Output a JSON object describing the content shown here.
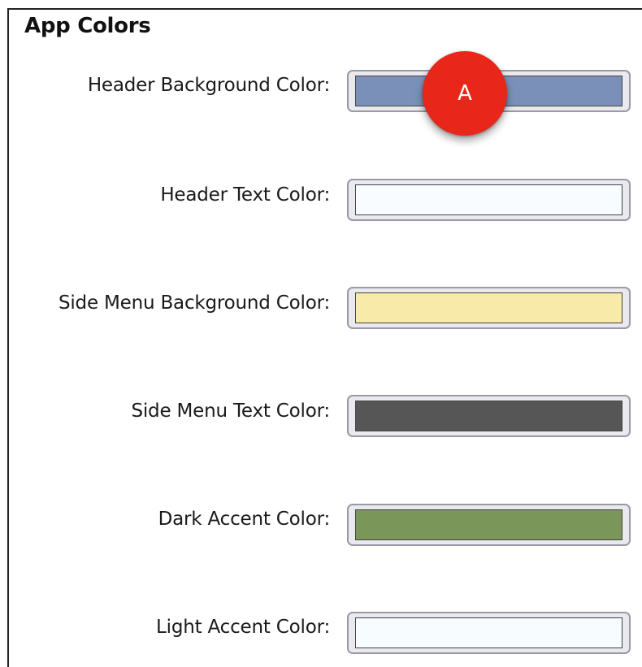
{
  "section": {
    "title": "App Colors"
  },
  "marker": {
    "label": "A",
    "color": "#e8261a"
  },
  "rows": [
    {
      "label": "Header Background Color:",
      "color": "#7b90b9"
    },
    {
      "label": "Header Text Color:",
      "color": "#f8fcff"
    },
    {
      "label": "Side Menu Background Color:",
      "color": "#f8eaa8"
    },
    {
      "label": "Side Menu Text Color:",
      "color": "#565656"
    },
    {
      "label": "Dark Accent Color:",
      "color": "#7b9659"
    },
    {
      "label": "Light Accent Color:",
      "color": "#f6fcff"
    }
  ]
}
